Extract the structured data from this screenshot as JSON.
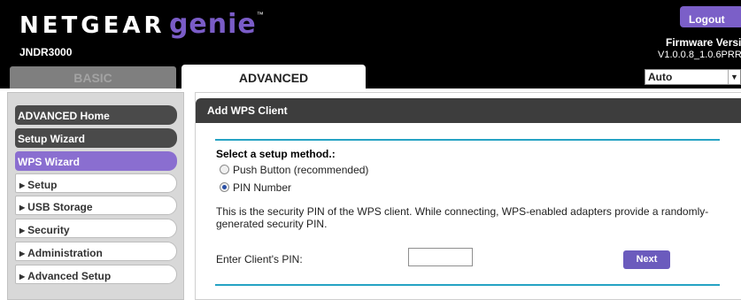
{
  "header": {
    "logo_brand": "NETGEAR",
    "logo_product": "genie",
    "logo_tm": "™",
    "model": "JNDR3000",
    "logout_label": "Logout",
    "firmware_label": "Firmware Versio",
    "firmware_version": "V1.0.0.8_1.0.6PRR"
  },
  "tabs": [
    {
      "label": "BASIC",
      "active": false
    },
    {
      "label": "ADVANCED",
      "active": true
    }
  ],
  "language_select": {
    "value": "Auto"
  },
  "sidebar": {
    "items": [
      {
        "label": "ADVANCED Home",
        "style": "dark"
      },
      {
        "label": "Setup Wizard",
        "style": "dark"
      },
      {
        "label": "WPS Wizard",
        "style": "active"
      },
      {
        "label": "Setup",
        "style": "expandable"
      },
      {
        "label": "USB Storage",
        "style": "expandable"
      },
      {
        "label": "Security",
        "style": "expandable"
      },
      {
        "label": "Administration",
        "style": "expandable"
      },
      {
        "label": "Advanced Setup",
        "style": "expandable"
      }
    ]
  },
  "main": {
    "title": "Add WPS Client",
    "select_label": "Select a setup method.:",
    "options": [
      {
        "label": "Push Button (recommended)",
        "selected": false
      },
      {
        "label": "PIN Number",
        "selected": true
      }
    ],
    "description": "This is the security PIN of the WPS client. While connecting, WPS-enabled adapters provide a randomly-generated security PIN.",
    "pin_label": "Enter Client's PIN:",
    "pin_value": "",
    "next_label": "Next"
  },
  "colors": {
    "accent_purple": "#8a6ed0",
    "header_bg": "#000000",
    "rule_blue": "#26a3c4"
  }
}
